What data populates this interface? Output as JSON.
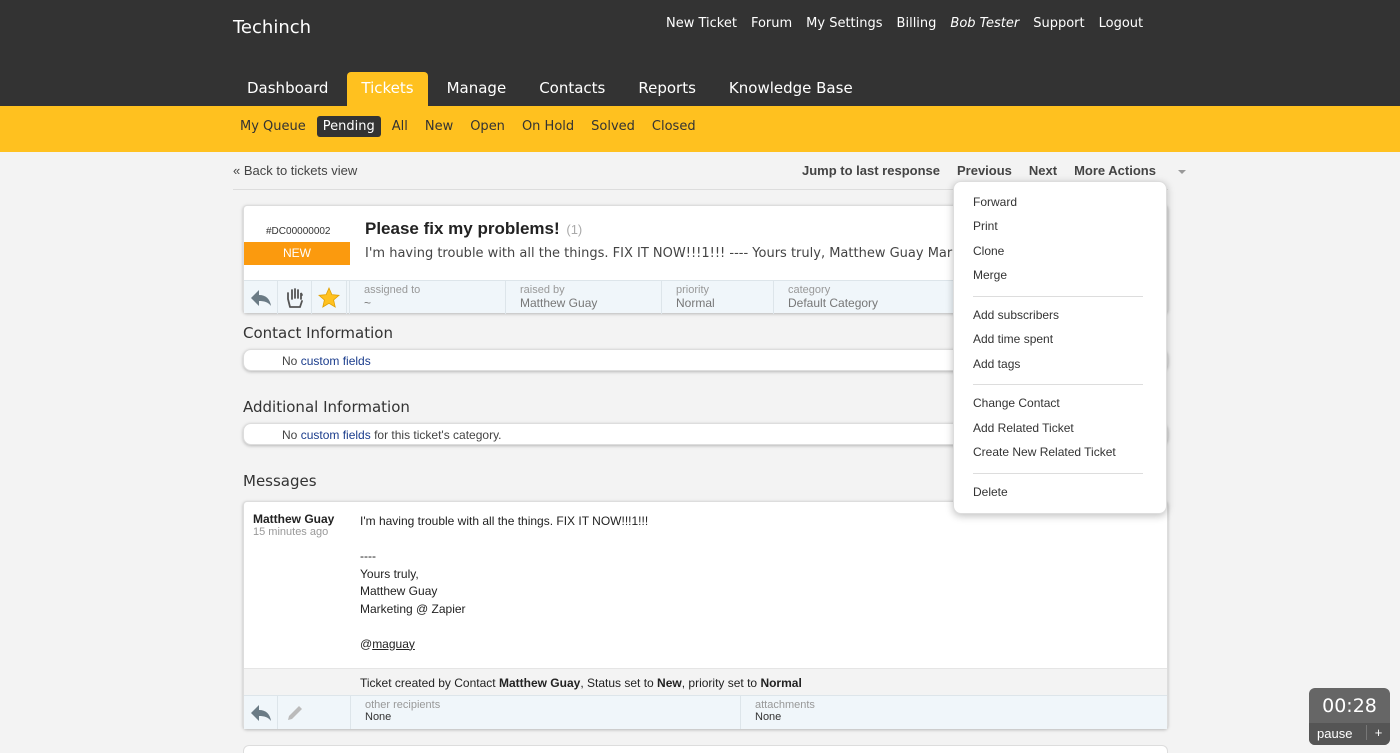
{
  "brand": "Techinch",
  "top_links": {
    "new_ticket": "New Ticket",
    "forum": "Forum",
    "my_settings": "My Settings",
    "billing": "Billing",
    "user": "Bob Tester",
    "support": "Support",
    "logout": "Logout"
  },
  "main_tabs": {
    "dashboard": "Dashboard",
    "tickets": "Tickets",
    "manage": "Manage",
    "contacts": "Contacts",
    "reports": "Reports",
    "knowledge_base": "Knowledge Base"
  },
  "sub_tabs": {
    "my_queue": "My Queue",
    "pending": "Pending",
    "all": "All",
    "new": "New",
    "open": "Open",
    "on_hold": "On Hold",
    "solved": "Solved",
    "closed": "Closed"
  },
  "toolbar": {
    "back": "« Back to tickets view",
    "jump": "Jump to last response",
    "previous": "Previous",
    "next": "Next",
    "more_actions": "More Actions"
  },
  "ticket": {
    "id": "#DC00000002",
    "status": "NEW",
    "title": "Please fix my problems!",
    "count": "(1)",
    "snippet": "I'm having trouble with all the things. FIX IT NOW!!!1!!! ---- Yours truly, Matthew Guay Marketing @ Zap...",
    "assigned_label": "assigned to",
    "assigned_value": "~",
    "raised_label": "raised by",
    "raised_value": "Matthew Guay",
    "priority_label": "priority",
    "priority_value": "Normal",
    "category_label": "category",
    "category_value": "Default Category"
  },
  "contact_info": {
    "title": "Contact Information",
    "prefix": "No",
    "link": "custom fields"
  },
  "additional_info": {
    "title": "Additional Information",
    "prefix": "No",
    "link": "custom fields",
    "suffix": "for this ticket's category."
  },
  "messages": {
    "title": "Messages",
    "author": "Matthew Guay",
    "time": "15 minutes ago",
    "body_line1": "I'm having trouble with all the things. FIX IT NOW!!!1!!!",
    "body_line2": "----",
    "body_line3": "Yours truly,",
    "body_line4": "Matthew Guay",
    "body_line5": "Marketing @ Zapier",
    "body_handle_at": "@",
    "body_handle": "maguay",
    "log_prefix": "Ticket created by Contact",
    "log_contact": "Matthew Guay",
    "log_mid1": ", Status set to",
    "log_status": "New",
    "log_mid2": ", priority set to",
    "log_priority": "Normal",
    "other_recipients_label": "other recipients",
    "other_recipients_value": "None",
    "attachments_label": "attachments",
    "attachments_value": "None"
  },
  "dropdown": {
    "forward": "Forward",
    "print": "Print",
    "clone": "Clone",
    "merge": "Merge",
    "add_subscribers": "Add subscribers",
    "add_time_spent": "Add time spent",
    "add_tags": "Add tags",
    "change_contact": "Change Contact",
    "add_related_ticket": "Add Related Ticket",
    "create_new_related_ticket": "Create New Related Ticket",
    "delete": "Delete"
  },
  "timer": {
    "time": "00:28",
    "pause": "pause",
    "plus": "+"
  },
  "colors": {
    "header_bg": "#333333",
    "accent_yellow": "#ffc11f",
    "status_orange": "#fb9a0e",
    "link_blue": "#1a3c8c"
  }
}
